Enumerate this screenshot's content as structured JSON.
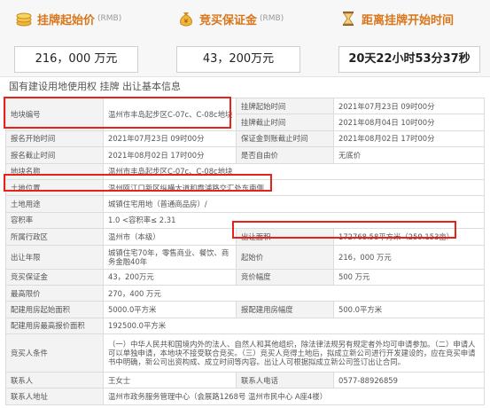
{
  "colors": {
    "accent": "#d9761a",
    "highlight": "#e5231b",
    "row_key_bg": "#f3f3f3"
  },
  "cards": [
    {
      "icon": "coins-icon",
      "label": "挂牌起始价",
      "unit": "(RMB)",
      "value": "216，000 万元"
    },
    {
      "icon": "money-bag-icon",
      "label": "竞买保证金",
      "unit": "(RMB)",
      "value": "43，200万元"
    },
    {
      "icon": "hourglass-icon",
      "label": "距离挂牌开始时间",
      "unit": "",
      "value": "20天22小时53分37秒"
    }
  ],
  "section_title": "国有建设用地使用权 挂牌 出让基本信息",
  "rows": [
    {
      "k1": "地块编号",
      "v1": "温州市丰岛起步区C-07c、C-08c地块",
      "k2": "挂牌起始时间",
      "v2": "2021年07月23日  09时00分"
    },
    {
      "k1": "",
      "v1": "",
      "k2": "挂牌截止时间",
      "v2": "2021年08月04日  10时00分"
    },
    {
      "k1": "报名开始时间",
      "v1": "2021年07月23日  09时00分",
      "k2": "保证金到账截止时间",
      "v2": "2021年08月02日  17时00分"
    },
    {
      "k1": "报名截止时间",
      "v1": "2021年08月02日  17时00分",
      "k2": "是否自由价",
      "v2": "无底价"
    },
    {
      "k1": "地块名称",
      "v1": "温州市丰岛起步区C-07c、C-08c地块",
      "k2": "",
      "v2": ""
    },
    {
      "k1": "土地位置",
      "v1": "温州瓯江口新区纵横大道和霞浦路交汇处东南侧",
      "k2": "",
      "v2": ""
    },
    {
      "k1": "土地用途",
      "v1": "城镇住宅用地（普通商品房）/",
      "k2": "",
      "v2": ""
    },
    {
      "k1": "容积率",
      "v1": "1.0 <容积率≤ 2.31",
      "k2": "",
      "v2": ""
    },
    {
      "k1": "所属行政区",
      "v1": "温州市（本级）",
      "k2": "出让面积",
      "v2": "172768.58平方米（259.153亩）"
    },
    {
      "k1": "出让年限",
      "v1": "城镇住宅70年，零售商业、餐饮、商务金融40年",
      "k2": "起始价",
      "v2": "216，000 万元"
    },
    {
      "k1": "竞买保证金",
      "v1": "43，200万元",
      "k2": "竞价幅度",
      "v2": "500 万元"
    },
    {
      "k1": "最高限价",
      "v1": "270，400 万元",
      "k2": "",
      "v2": ""
    },
    {
      "k1": "配建用房起始面积",
      "v1": "5000.0平方米",
      "k2": "报配建用房幅度",
      "v2": "500.0平方米"
    },
    {
      "k1": "配建用房最高报价面积",
      "v1": "192500.0平方米",
      "k2": "",
      "v2": ""
    },
    {
      "k1": "竞买人条件",
      "v1": "（一）中华人民共和国境内外的法人、自然人和其他组织，除法律法规另有规定者外均可申请参加。（二）申请人可以单独申请，本地块不接受联合竞买。（三）竞买人竞得土地后，拟成立新公司进行开发建设的，应在竞买申请书中明确，新公司出资构成、成立时间等内容。出让人可根据拟成立新公司签订出让合同。",
      "k2": "",
      "v2": ""
    },
    {
      "k1": "联系人",
      "v1": "王女士",
      "k2": "联系人电话",
      "v2": "0577-88926859"
    },
    {
      "k1": "联系人地址",
      "v1": "温州市政务服务管理中心（会展路1268号 温州市民中心 A座4楼）",
      "k2": "",
      "v2": ""
    }
  ]
}
